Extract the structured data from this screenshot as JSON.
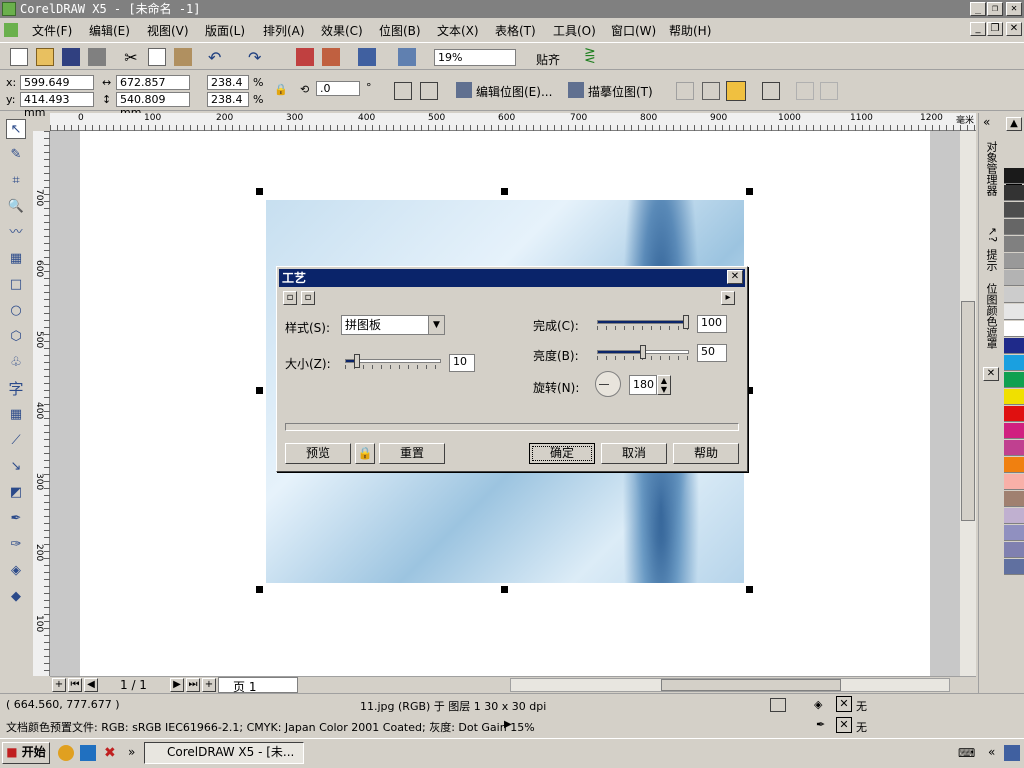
{
  "window": {
    "title": "CorelDRAW X5 - [未命名 -1]",
    "min": "_",
    "restore": "❐",
    "close": "✕"
  },
  "menu": [
    "文件(F)",
    "编辑(E)",
    "视图(V)",
    "版面(L)",
    "排列(A)",
    "效果(C)",
    "位图(B)",
    "文本(X)",
    "表格(T)",
    "工具(O)",
    "窗口(W)",
    "帮助(H)"
  ],
  "toolbar": {
    "zoom": "19%",
    "snap": "贴齐"
  },
  "propbar": {
    "x": "599.649 mm",
    "y": "414.493 mm",
    "w": "672.857 mm",
    "h": "540.809 mm",
    "sx": "238.4",
    "sy": "238.4",
    "pct": "%",
    "angle": ".0",
    "deg": "°",
    "edit_bitmap": "编辑位图(E)...",
    "trace_bitmap": "描摹位图(T)"
  },
  "ruler": {
    "h_ticks": [
      "0",
      "100",
      "200",
      "300",
      "400",
      "500",
      "600",
      "700",
      "800",
      "900",
      "1000",
      "1100",
      "1200"
    ],
    "unit": "毫米",
    "v_ticks": [
      "700",
      "600",
      "500",
      "400",
      "300",
      "200",
      "100"
    ]
  },
  "dialog": {
    "title": "工艺",
    "style_label": "样式(S):",
    "style_value": "拼图板",
    "size_label": "大小(Z):",
    "size_value": "10",
    "size_level": 0.1,
    "complete_label": "完成(C):",
    "complete_value": "100",
    "complete_level": 1.0,
    "brightness_label": "亮度(B):",
    "brightness_value": "50",
    "brightness_level": 0.5,
    "rotate_label": "旋转(N):",
    "rotate_value": "180",
    "preview": "预览",
    "reset": "重置",
    "ok": "确定",
    "cancel": "取消",
    "help": "帮助"
  },
  "pagenav": {
    "counter": "1 / 1",
    "tab": "页 1"
  },
  "status": {
    "coords": "( 664.560, 777.677 )",
    "info": "11.jpg (RGB) 于 图层 1 30 x 30 dpi",
    "profile": "文档颜色预置文件: RGB: sRGB IEC61966-2.1; CMYK: Japan Color 2001 Coated; 灰度: Dot Gain 15%",
    "fill_none": "无",
    "outline_none": "无"
  },
  "taskbar": {
    "start": "开始",
    "task": "CorelDRAW X5 - [未..."
  },
  "docker": {
    "tab1": "对象管理器",
    "tab2": "提示",
    "tab3": "位图颜色遮罩"
  },
  "palette": [
    "#1a1a1a",
    "#333333",
    "#4d4d4d",
    "#666666",
    "#808080",
    "#999999",
    "#b3b3b3",
    "#cccccc",
    "#e6e6e6",
    "#ffffff",
    "#1f2a8a",
    "#1aa0e0",
    "#10a050",
    "#f0e000",
    "#e01010",
    "#d02080",
    "#c04090",
    "#f08010",
    "#f8b0a8",
    "#a08070",
    "#c0b0d0",
    "#9090c0",
    "#8080b0",
    "#6070a0"
  ]
}
